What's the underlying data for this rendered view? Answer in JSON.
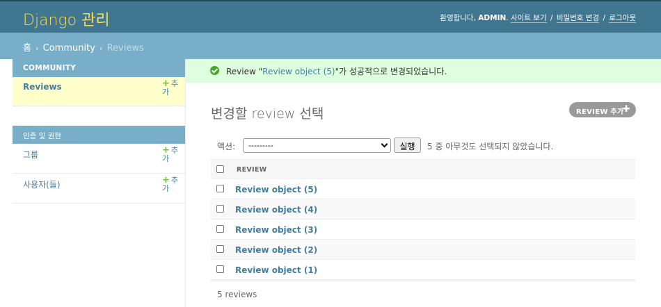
{
  "header": {
    "site_name": "Django 관리",
    "welcome": "환영합니다,",
    "username": "ADMIN",
    "links": [
      "사이트 보기",
      "비밀번호 변경",
      "로그아웃"
    ]
  },
  "breadcrumbs": {
    "home": "홈",
    "app": "Community",
    "current": "Reviews"
  },
  "sidebar": {
    "apps": [
      {
        "caption": "COMMUNITY",
        "models": [
          {
            "label": "Reviews",
            "add_label": "추가"
          }
        ]
      },
      {
        "caption": "인증 및 권한",
        "models": [
          {
            "label": "그룹",
            "add_label": "추가"
          },
          {
            "label": "사용자(들)",
            "add_label": "추가"
          }
        ]
      }
    ]
  },
  "message": {
    "prefix": "Review \"",
    "object": "Review object (5)",
    "suffix": "\"가 성공적으로 변경되었습니다."
  },
  "main": {
    "title": "변경할 review 선택",
    "add_button": "REVIEW 추가",
    "actions": {
      "label": "액션:",
      "selected": "---------",
      "go_label": "실행",
      "counter": "5 중 아무것도 선택되지 않았습니다."
    },
    "table": {
      "column": "REVIEW",
      "rows": [
        "Review object (5)",
        "Review object (4)",
        "Review object (3)",
        "Review object (2)",
        "Review object (1)"
      ]
    },
    "paginator": "5 reviews"
  },
  "colors": {
    "header_bg": "#417690",
    "breadcrumbs_bg": "#79aec8",
    "accent": "#f5dd5d",
    "link": "#447e9b",
    "add_green": "#70bf2b",
    "success_bg": "#dddddd"
  }
}
